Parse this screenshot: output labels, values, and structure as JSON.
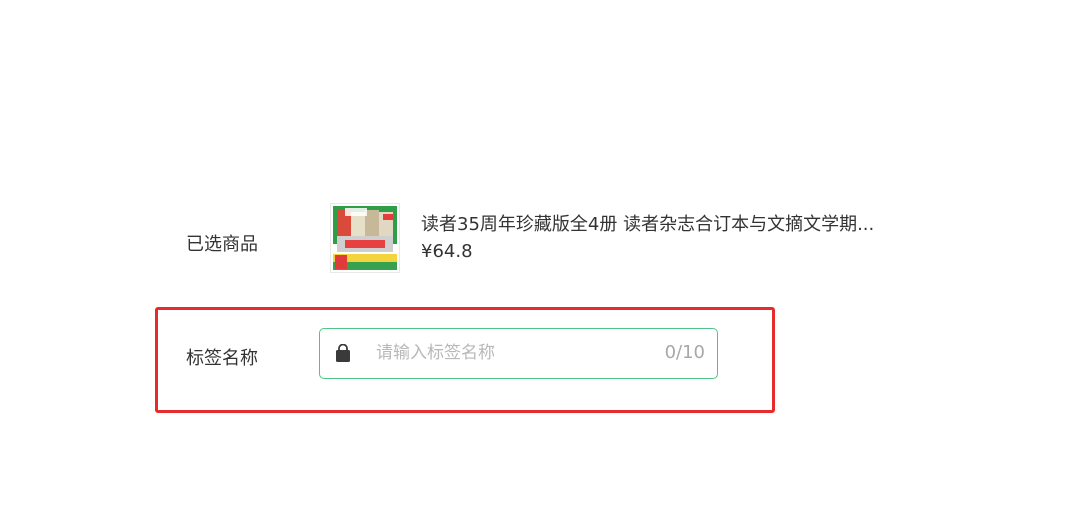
{
  "form": {
    "selected_product_label": "已选商品",
    "tag_name_label": "标签名称"
  },
  "product": {
    "title": "读者35周年珍藏版全4册 读者杂志合订本与文摘文学期...",
    "price": "¥64.8",
    "thumbnail_icon": "book-cover-image"
  },
  "tag_input": {
    "icon": "shopping-bag-icon",
    "value": "",
    "placeholder": "请输入标签名称",
    "counter": "0/10"
  },
  "colors": {
    "input_border": "#52c48a",
    "highlight_border": "#e52b2b",
    "placeholder": "#b8b8b8"
  }
}
